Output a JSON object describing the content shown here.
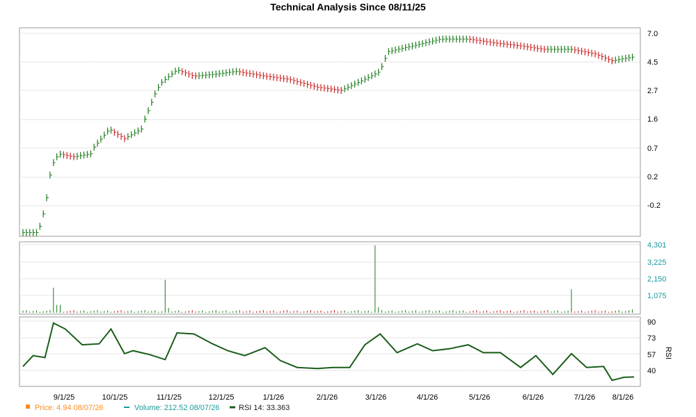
{
  "chart_data": {
    "type": "line",
    "title": "Technical Analysis Since 08/11/25",
    "x_ticks": [
      "9/1/25",
      "10/1/25",
      "11/1/25",
      "12/1/25",
      "1/1/26",
      "2/1/26",
      "3/1/26",
      "4/1/26",
      "5/1/26",
      "6/1/26",
      "7/1/26",
      "8/1/26"
    ],
    "x_range": [
      "2025-08-11",
      "2026-08-07"
    ],
    "panels": {
      "price": {
        "label": "Price",
        "y_ticks": [
          "7.0",
          "4.5",
          "2.7",
          "1.6",
          "0.7",
          "0.2",
          "-0.2"
        ],
        "series": [
          {
            "name": "Price",
            "color": "#ff8c1a",
            "x": [
              "2025-08-11",
              "2025-08-20",
              "2025-08-28",
              "2025-09-01",
              "2025-09-10",
              "2025-09-20",
              "2025-10-01",
              "2025-10-10",
              "2025-10-20",
              "2025-11-01",
              "2025-11-10",
              "2025-11-20",
              "2025-12-01",
              "2025-12-15",
              "2026-01-01",
              "2026-01-15",
              "2026-02-01",
              "2026-02-15",
              "2026-03-01",
              "2026-03-10",
              "2026-03-15",
              "2026-04-01",
              "2026-04-15",
              "2026-05-01",
              "2026-05-15",
              "2026-06-01",
              "2026-06-15",
              "2026-07-01",
              "2026-07-15",
              "2026-07-25",
              "2026-08-07"
            ],
            "values": [
              -0.9,
              -0.9,
              0.4,
              0.6,
              0.55,
              0.6,
              1.3,
              1.0,
              1.3,
              3.2,
              4.0,
              3.6,
              3.7,
              3.9,
              3.6,
              3.4,
              2.9,
              2.7,
              3.4,
              3.9,
              5.4,
              6.0,
              6.5,
              6.5,
              6.2,
              5.9,
              5.6,
              5.6,
              5.2,
              4.6,
              4.94
            ]
          }
        ]
      },
      "volume": {
        "label": "Volume",
        "y_ticks": [
          "4,301",
          "3,225",
          "2,150",
          "1,075"
        ],
        "series": [
          {
            "name": "Volume",
            "color": "#1a9a9a",
            "x": [
              "2025-08-11",
              "2025-08-29",
              "2025-09-01",
              "2025-11-03",
              "2025-11-04",
              "2026-03-07",
              "2026-03-08",
              "2026-07-01",
              "2026-08-07"
            ],
            "values": [
              80,
              1580,
              500,
              2080,
              300,
              4250,
              350,
              1480,
              212.52
            ]
          }
        ]
      },
      "rsi": {
        "label": "RSI",
        "y_ticks": [
          "90",
          "73",
          "57",
          "40"
        ],
        "series": [
          {
            "name": "RSI 14",
            "color": "#1a5c1a",
            "x": [
              "2025-08-11",
              "2025-08-17",
              "2025-08-24",
              "2025-08-29",
              "2025-09-05",
              "2025-09-15",
              "2025-09-25",
              "2025-10-02",
              "2025-10-10",
              "2025-10-15",
              "2025-10-25",
              "2025-11-03",
              "2025-11-10",
              "2025-11-20",
              "2025-12-01",
              "2025-12-10",
              "2025-12-20",
              "2026-01-01",
              "2026-01-10",
              "2026-01-20",
              "2026-02-01",
              "2026-02-10",
              "2026-02-20",
              "2026-03-01",
              "2026-03-10",
              "2026-03-20",
              "2026-04-01",
              "2026-04-10",
              "2026-04-20",
              "2026-05-01",
              "2026-05-10",
              "2026-05-20",
              "2026-06-01",
              "2026-06-10",
              "2026-06-20",
              "2026-07-01",
              "2026-07-10",
              "2026-07-20",
              "2026-07-25",
              "2026-08-01",
              "2026-08-07"
            ],
            "values": [
              44,
              55,
              53,
              88,
              82,
              66,
              67,
              82,
              57,
              60,
              56,
              51,
              78,
              77,
              67,
              60,
              55,
              63,
              50,
              43,
              42,
              43,
              43,
              66,
              77,
              58,
              67,
              60,
              62,
              66,
              58,
              58,
              43,
              55,
              36,
              57,
              43,
              44,
              30,
              33,
              33.363
            ]
          }
        ]
      }
    },
    "grid": true
  },
  "legend": {
    "price": {
      "label": "Price: 4.94 08/07/26",
      "color": "#ff8c1a"
    },
    "volume": {
      "label": "Volume: 212.52 08/07/26",
      "color": "#1a9a9a"
    },
    "rsi": {
      "label": "RSI 14: 33.363",
      "color": "#1a5c1a"
    }
  },
  "rsi_axis_label": "RSI",
  "colors": {
    "up": "#1a7a1a",
    "down": "#c81e1e",
    "grid": "#c8c8c8",
    "frame": "#999999"
  }
}
